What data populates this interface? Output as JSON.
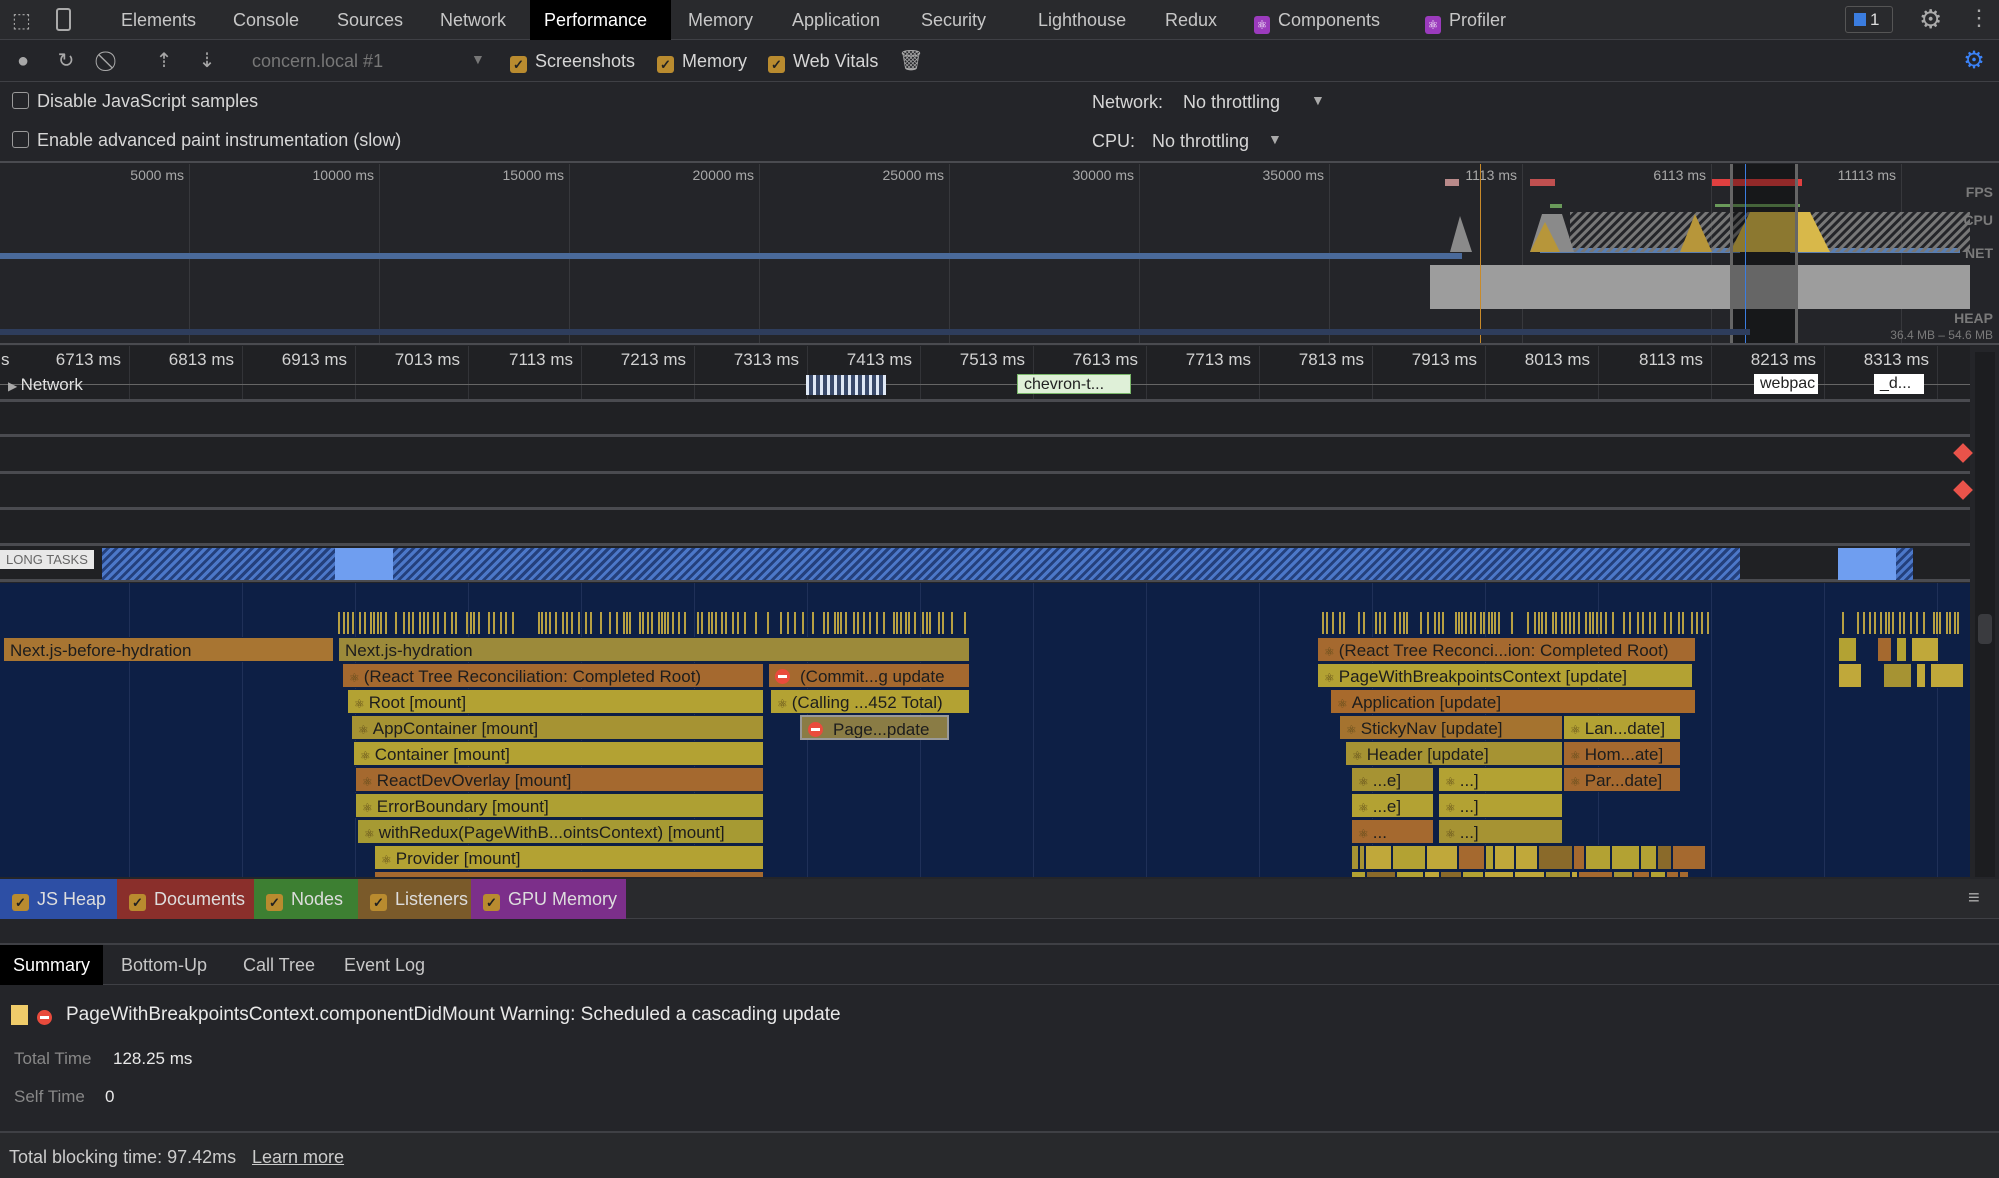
{
  "tabs": [
    "Elements",
    "Console",
    "Sources",
    "Network",
    "Performance",
    "Memory",
    "Application",
    "Security",
    "Lighthouse",
    "Redux",
    "Components",
    "Profiler"
  ],
  "active_tab": "Performance",
  "issues_badge": "1",
  "toolbar": {
    "profile_select": "concern.local #1",
    "screenshots_label": "Screenshots",
    "memory_label": "Memory",
    "web_vitals_label": "Web Vitals",
    "screenshots_checked": true,
    "memory_checked": true,
    "web_vitals_checked": true
  },
  "settings": {
    "disable_js_samples": "Disable JavaScript samples",
    "advanced_paint": "Enable advanced paint instrumentation (slow)",
    "network_label": "Network:",
    "network_value": "No throttling",
    "cpu_label": "CPU:",
    "cpu_value": "No throttling"
  },
  "overview": {
    "ticks": [
      "5000 ms",
      "10000 ms",
      "15000 ms",
      "20000 ms",
      "25000 ms",
      "30000 ms",
      "35000 ms",
      "1113 ms",
      "6113 ms",
      "11113 ms"
    ],
    "lanes": [
      "FPS",
      "CPU",
      "NET",
      "HEAP"
    ],
    "heap_range": "36.4 MB – 54.6 MB"
  },
  "ruler": {
    "ticks": [
      "6713 ms",
      "6813 ms",
      "6913 ms",
      "7013 ms",
      "7113 ms",
      "7213 ms",
      "7313 ms",
      "7413 ms",
      "7513 ms",
      "7613 ms",
      "7713 ms",
      "7813 ms",
      "7913 ms",
      "8013 ms",
      "8113 ms",
      "8213 ms",
      "8313 ms"
    ],
    "partial": "s"
  },
  "network_track": {
    "label": "Network",
    "requests": [
      "chevron-t...",
      "webpac",
      "_d..."
    ]
  },
  "long_tasks_label": "LONG TASKS",
  "flame": {
    "left": [
      "Next.js-before-hydration",
      "Next.js-hydration",
      "(React Tree Reconciliation: Completed Root)",
      "(Commit...g update",
      "Root [mount]",
      "(Calling ...452 Total)",
      "AppContainer [mount]",
      "Page...pdate",
      "Container [mount]",
      "ReactDevOverlay [mount]",
      "ErrorBoundary [mount]",
      "withRedux(PageWithB...ointsContext) [mount]",
      "Provider [mount]"
    ],
    "right": [
      "(React Tree Reconci...ion: Completed Root)",
      "PageWithBreakpointsContext [update]",
      "Application [update]",
      "StickyNav [update]",
      "Lan...date]",
      "Header [update]",
      "Hom...ate]",
      "...e]",
      "...]",
      "Par...date]",
      "...e]",
      "...]",
      "...",
      "...]"
    ]
  },
  "memory_counters": [
    {
      "label": "JS Heap",
      "color": "#2d4fa5"
    },
    {
      "label": "Documents",
      "color": "#8a2f2b"
    },
    {
      "label": "Nodes",
      "color": "#3d7f32"
    },
    {
      "label": "Listeners",
      "color": "#7a5a2a"
    },
    {
      "label": "GPU Memory",
      "color": "#7c2f8a"
    }
  ],
  "details_tabs": [
    "Summary",
    "Bottom-Up",
    "Call Tree",
    "Event Log"
  ],
  "summary": {
    "title": "PageWithBreakpointsContext.componentDidMount Warning: Scheduled a cascading update",
    "total_time_label": "Total Time",
    "total_time": "128.25 ms",
    "self_time_label": "Self Time",
    "self_time": "0"
  },
  "footer": {
    "text": "Total blocking time: 97.42ms",
    "link": "Learn more"
  }
}
